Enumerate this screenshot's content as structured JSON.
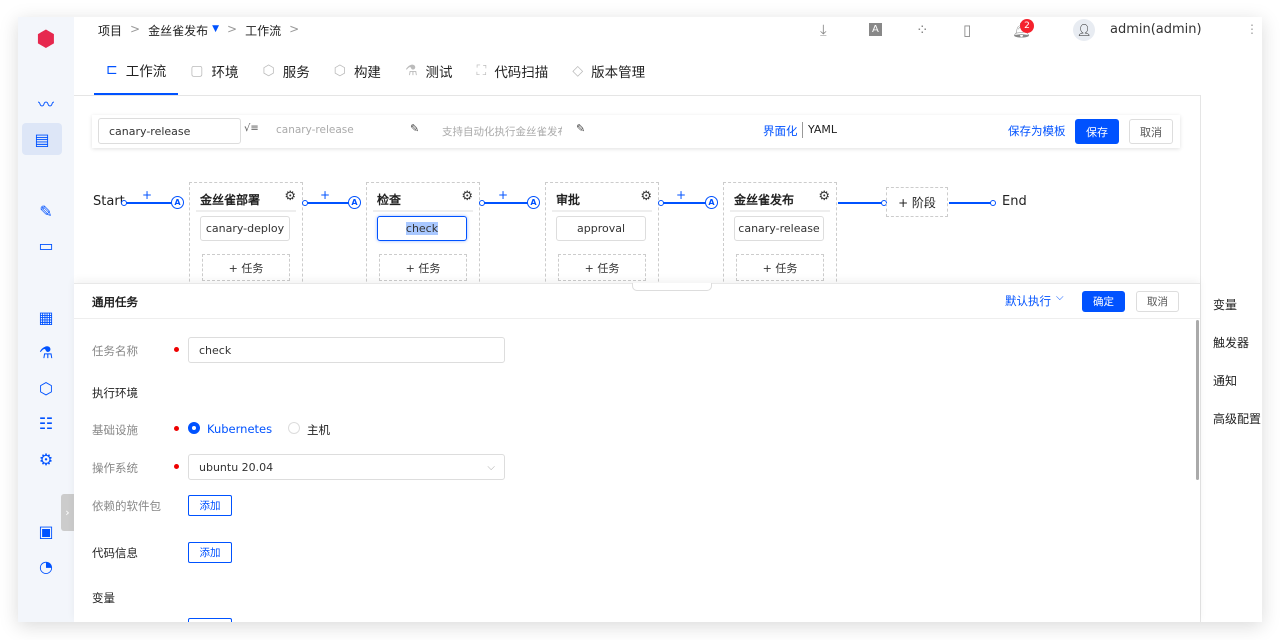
{
  "breadcrumb": {
    "items": [
      "项目",
      "金丝雀发布",
      "工作流"
    ],
    "separator": ">"
  },
  "header": {
    "notification_count": "2",
    "user": "admin(admin)"
  },
  "tabs": [
    {
      "label": "工作流",
      "active": true
    },
    {
      "label": "环境"
    },
    {
      "label": "服务"
    },
    {
      "label": "构建"
    },
    {
      "label": "测试"
    },
    {
      "label": "代码扫描"
    },
    {
      "label": "版本管理"
    }
  ],
  "toolbar": {
    "name_value": "canary-release",
    "display_name_placeholder": "canary-release",
    "description_placeholder": "支持自动化执行金丝雀发布",
    "mode_ui": "界面化",
    "mode_yaml": "YAML",
    "save_template": "保存为模板",
    "save": "保存",
    "cancel": "取消"
  },
  "pipeline": {
    "start": "Start",
    "end": "End",
    "add_stage": "+ 阶段",
    "plus": "+",
    "approval_badge": "A",
    "stages": [
      {
        "title": "金丝雀部署",
        "job": "canary-deploy",
        "add_task": "+ 任务"
      },
      {
        "title": "检查",
        "job": "check",
        "add_task": "+ 任务",
        "selected": true
      },
      {
        "title": "审批",
        "job": "approval",
        "add_task": "+ 任务"
      },
      {
        "title": "金丝雀发布",
        "job": "canary-release",
        "add_task": "+ 任务"
      }
    ]
  },
  "right_panel": {
    "items": [
      "变量",
      "触发器",
      "通知",
      "高级配置"
    ]
  },
  "task_panel": {
    "title": "通用任务",
    "exec_mode": "默认执行",
    "confirm": "确定",
    "cancel": "取消",
    "task_name_label": "任务名称",
    "task_name_value": "check",
    "exec_env_label": "执行环境",
    "infra_label": "基础设施",
    "infra_options": [
      "Kubernetes",
      "主机"
    ],
    "infra_selected": "Kubernetes",
    "os_label": "操作系统",
    "os_value": "ubuntu 20.04",
    "packages_label": "依赖的软件包",
    "add": "添加",
    "code_label": "代码信息",
    "vars_label": "变量"
  },
  "colors": {
    "accent": "#0052ff",
    "badge": "#f5222d"
  }
}
